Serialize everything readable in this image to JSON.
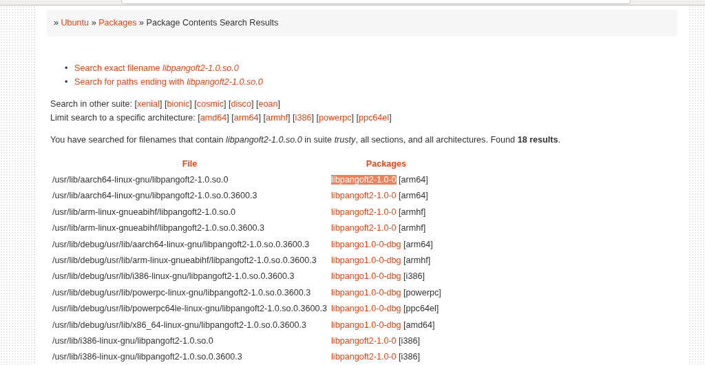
{
  "breadcrumb": [
    {
      "kind": "separator",
      "text": "»"
    },
    {
      "kind": "link",
      "text": "Ubuntu"
    },
    {
      "kind": "separator",
      "text": "»"
    },
    {
      "kind": "link",
      "text": "Packages"
    },
    {
      "kind": "separator",
      "text": "»"
    },
    {
      "kind": "current",
      "text": "Package Contents Search Results"
    }
  ],
  "bullet": "•",
  "search_links": [
    "Search exact filename *libpangoft2-1.0.so.0*",
    "Search for paths ending with *libpangoft2-1.0.so.0*"
  ],
  "bracket_open": "[",
  "bracket_close": "]",
  "other_suites": {
    "label": "Search in other suite:",
    "links": [
      "xenial",
      "bionic",
      "cosmic",
      "disco",
      "eoan"
    ]
  },
  "architectures": {
    "label": "Limit search to a specific architecture:",
    "links": [
      "amd64",
      "arm64",
      "armhf",
      "i386",
      "powerpc",
      "ppc64el"
    ]
  },
  "summary": "You have searched for filenames that contain *libpangoft2-1.0.so.0* in suite *trusty*, all sections, and all architectures. Found **18 results**.",
  "table": {
    "columns": [
      "File",
      "Packages"
    ],
    "rows": [
      {
        "file": "/usr/lib/aarch64-linux-gnu/libpangoft2-1.0.so.0",
        "package": "libpangoft2-1.0-0",
        "arch": "[arm64]",
        "selected": true
      },
      {
        "file": "/usr/lib/aarch64-linux-gnu/libpangoft2-1.0.so.0.3600.3",
        "package": "libpangoft2-1.0-0",
        "arch": "[arm64]",
        "selected": false
      },
      {
        "file": "/usr/lib/arm-linux-gnueabihf/libpangoft2-1.0.so.0",
        "package": "libpangoft2-1.0-0",
        "arch": "[armhf]",
        "selected": false
      },
      {
        "file": "/usr/lib/arm-linux-gnueabihf/libpangoft2-1.0.so.0.3600.3",
        "package": "libpangoft2-1.0-0",
        "arch": "[armhf]",
        "selected": false
      },
      {
        "file": "/usr/lib/debug/usr/lib/aarch64-linux-gnu/libpangoft2-1.0.so.0.3600.3",
        "package": "libpango1.0-0-dbg",
        "arch": "[arm64]",
        "selected": false
      },
      {
        "file": "/usr/lib/debug/usr/lib/arm-linux-gnueabihf/libpangoft2-1.0.so.0.3600.3",
        "package": "libpango1.0-0-dbg",
        "arch": "[armhf]",
        "selected": false
      },
      {
        "file": "/usr/lib/debug/usr/lib/i386-linux-gnu/libpangoft2-1.0.so.0.3600.3",
        "package": "libpango1.0-0-dbg",
        "arch": "[i386]",
        "selected": false
      },
      {
        "file": "/usr/lib/debug/usr/lib/powerpc-linux-gnu/libpangoft2-1.0.so.0.3600.3",
        "package": "libpango1.0-0-dbg",
        "arch": "[powerpc]",
        "selected": false
      },
      {
        "file": "/usr/lib/debug/usr/lib/powerpc64le-linux-gnu/libpangoft2-1.0.so.0.3600.3",
        "package": "libpango1.0-0-dbg",
        "arch": "[ppc64el]",
        "selected": false
      },
      {
        "file": "/usr/lib/debug/usr/lib/x86_64-linux-gnu/libpangoft2-1.0.so.0.3600.3",
        "package": "libpango1.0-0-dbg",
        "arch": "[amd64]",
        "selected": false
      },
      {
        "file": "/usr/lib/i386-linux-gnu/libpangoft2-1.0.so.0",
        "package": "libpangoft2-1.0-0",
        "arch": "[i386]",
        "selected": false
      },
      {
        "file": "/usr/lib/i386-linux-gnu/libpangoft2-1.0.so.0.3600.3",
        "package": "libpangoft2-1.0-0",
        "arch": "[i386]",
        "selected": false
      }
    ]
  }
}
